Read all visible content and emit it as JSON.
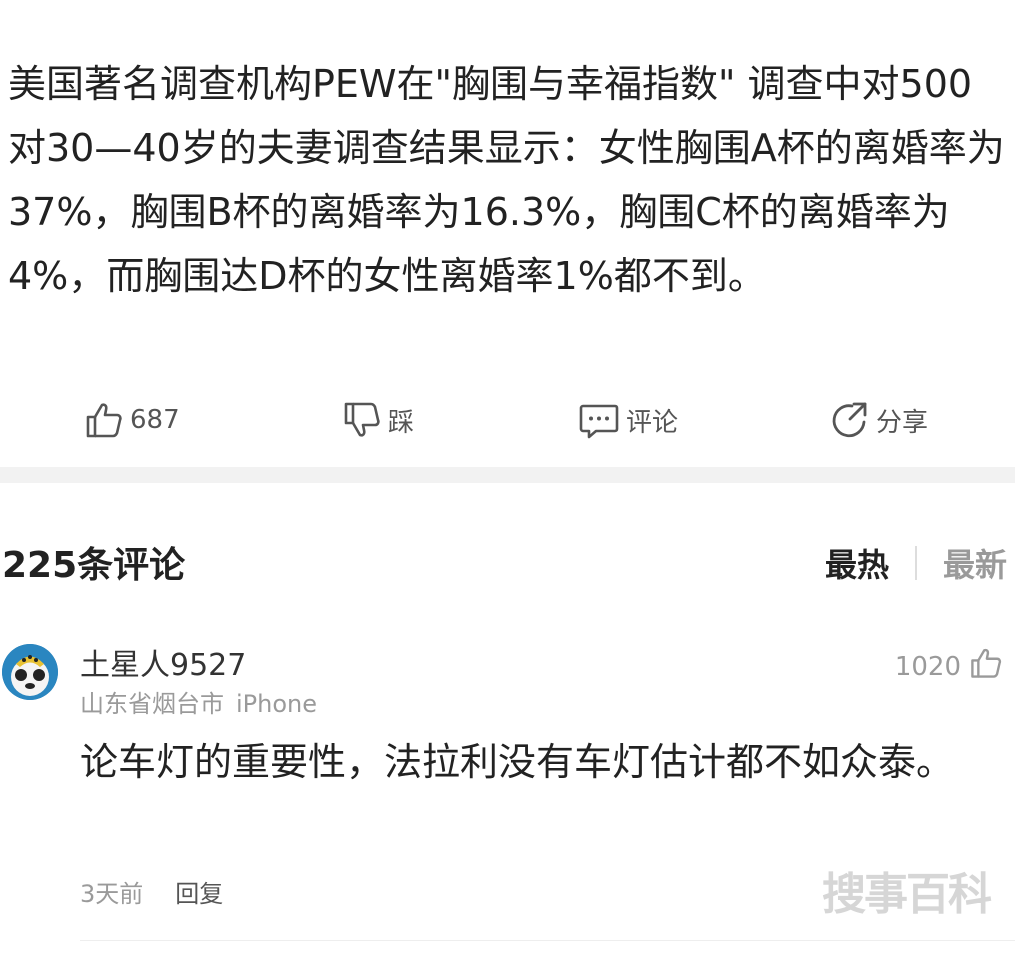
{
  "article": {
    "text": "美国著名调查机构PEW在\"胸围与幸福指数\" 调查中对500对30—40岁的夫妻调查结果显示：女性胸围A杯的离婚率为37%，胸围B杯的离婚率为16.3%，胸围C杯的离婚率为4%，而胸围达D杯的女性离婚率1%都不到。"
  },
  "actions": {
    "like_count": "687",
    "dislike_label": "踩",
    "comment_label": "评论",
    "share_label": "分享"
  },
  "comments_section": {
    "count_label": "225条评论",
    "sort_hot": "最热",
    "sort_new": "最新"
  },
  "comment": {
    "username": "土星人9527",
    "location": "山东省烟台市",
    "device": "iPhone",
    "likes": "1020",
    "text": "论车灯的重要性，法拉利没有车灯估计都不如众泰。",
    "time": "3天前",
    "reply_label": "回复"
  },
  "watermark": "搜事百科",
  "icons": [
    "thumbs-up-icon",
    "thumbs-down-icon",
    "comment-icon",
    "share-icon",
    "avatar"
  ],
  "colors": {
    "text": "#222222",
    "muted": "#9a9a9a",
    "divider": "#f2f2f2"
  }
}
